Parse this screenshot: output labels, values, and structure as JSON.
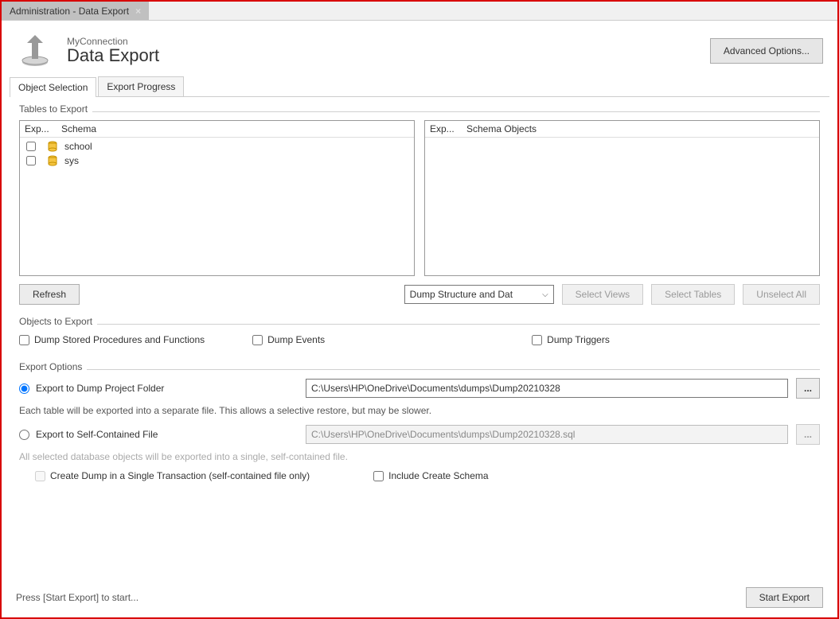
{
  "window": {
    "tab_title": "Administration - Data Export"
  },
  "header": {
    "connection": "MyConnection",
    "title": "Data Export",
    "advanced_label": "Advanced Options..."
  },
  "subtabs": {
    "object_selection": "Object Selection",
    "export_progress": "Export Progress"
  },
  "tables_section": {
    "legend": "Tables to Export",
    "left": {
      "col1": "Exp...",
      "col2": "Schema",
      "rows": [
        "school",
        "sys"
      ]
    },
    "right": {
      "col1": "Exp...",
      "col2": "Schema Objects"
    },
    "refresh": "Refresh",
    "dump_select": "Dump Structure and Dat",
    "select_views": "Select Views",
    "select_tables": "Select Tables",
    "unselect_all": "Unselect All"
  },
  "objects_section": {
    "legend": "Objects to Export",
    "stored_proc": "Dump Stored Procedures and Functions",
    "events": "Dump Events",
    "triggers": "Dump Triggers"
  },
  "export_options": {
    "legend": "Export Options",
    "folder_label": "Export to Dump Project Folder",
    "folder_path": "C:\\Users\\HP\\OneDrive\\Documents\\dumps\\Dump20210328",
    "folder_hint": "Each table will be exported into a separate file. This allows a selective restore, but may be slower.",
    "file_label": "Export to Self-Contained File",
    "file_path": "C:\\Users\\HP\\OneDrive\\Documents\\dumps\\Dump20210328.sql",
    "file_hint": "All selected database objects will be exported into a single, self-contained file.",
    "single_txn": "Create Dump in a Single Transaction (self-contained file only)",
    "include_schema": "Include Create Schema",
    "browse": "..."
  },
  "footer": {
    "status": "Press [Start Export] to start...",
    "start": "Start Export"
  }
}
